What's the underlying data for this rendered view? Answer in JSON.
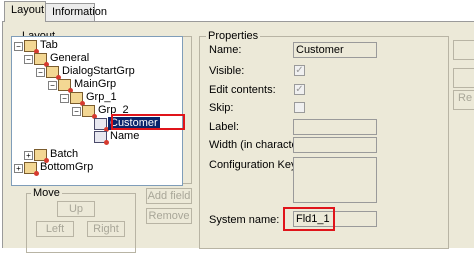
{
  "tabs": [
    {
      "label": "Layout",
      "active": true
    },
    {
      "label": "Information",
      "active": false
    }
  ],
  "layout_group": {
    "title": "Layout",
    "tree": [
      {
        "label": "Tab",
        "expanded": true,
        "level": 0
      },
      {
        "label": "General",
        "expanded": true,
        "level": 1
      },
      {
        "label": "DialogStartGrp",
        "expanded": true,
        "level": 2
      },
      {
        "label": "MainGrp",
        "expanded": true,
        "level": 3
      },
      {
        "label": "Grp_1",
        "expanded": true,
        "level": 4
      },
      {
        "label": "Grp_2",
        "expanded": true,
        "level": 5
      },
      {
        "label": "Customer",
        "selected": true,
        "level": 6
      },
      {
        "label": "Name",
        "level": 6
      },
      {
        "label": "Batch",
        "expanded": false,
        "level": 1
      },
      {
        "label": "BottomGrp",
        "expanded": false,
        "level": 0
      }
    ]
  },
  "move_group": {
    "title": "Move",
    "buttons": {
      "up": "Up",
      "left": "Left",
      "right": "Right"
    }
  },
  "actions": {
    "add_field": "Add field",
    "remove": "Remove"
  },
  "properties": {
    "title": "Properties",
    "name_label": "Name:",
    "name_value": "Customer",
    "visible_label": "Visible:",
    "visible_checked": true,
    "edit_label": "Edit contents:",
    "edit_checked": true,
    "skip_label": "Skip:",
    "skip_checked": false,
    "label_label": "Label:",
    "width_label": "Width (in characters):",
    "config_label": "Configuration Keys:",
    "system_name_label": "System name:",
    "system_name_value": "Fld1_1"
  },
  "right_buttons": {
    "button_1": "",
    "button_2": "",
    "button_3": "Re"
  },
  "highlight_color": "#e0141a"
}
